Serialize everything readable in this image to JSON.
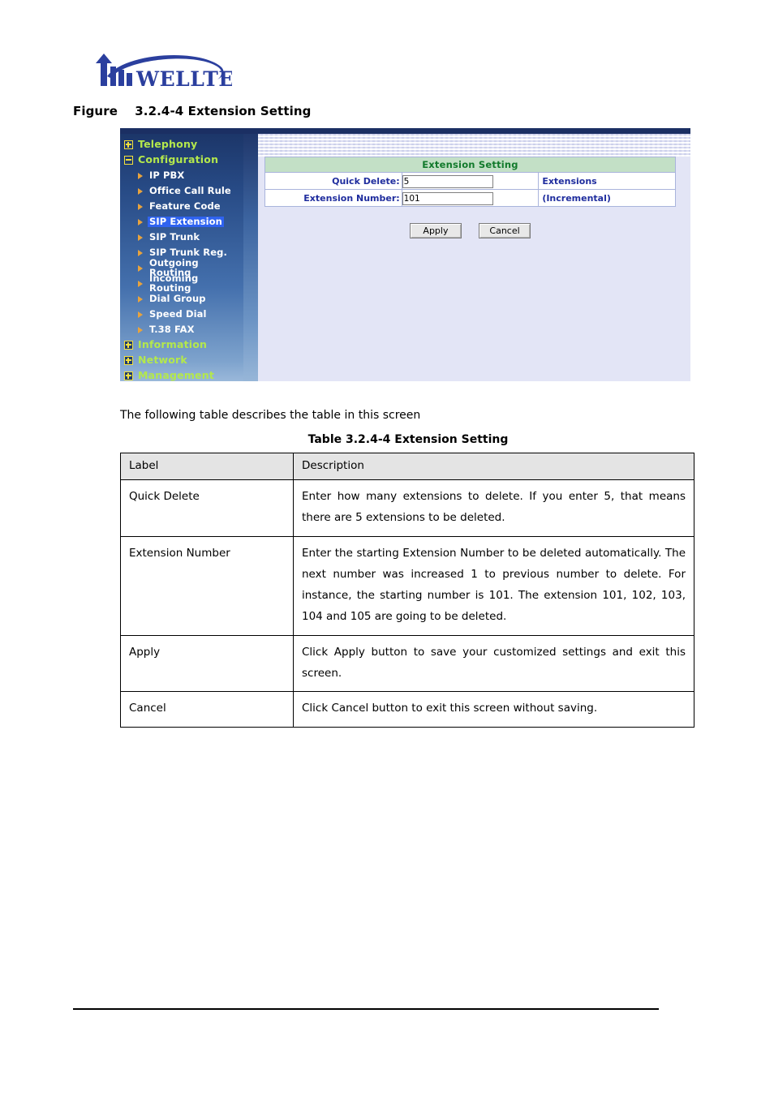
{
  "brand": {
    "logo_text": "WELLTECH",
    "logo_color": "#2b3f9e"
  },
  "figure": {
    "caption": "Figure    3.2.4-4 Extension Setting"
  },
  "device_ui": {
    "sidebar": {
      "top_items": [
        {
          "label": "Telephony",
          "state": "collapsed",
          "icon": "plus-box-icon"
        },
        {
          "label": "Configuration",
          "state": "expanded",
          "icon": "minus-box-icon"
        },
        {
          "label": "Information",
          "state": "collapsed",
          "icon": "plus-box-icon"
        },
        {
          "label": "Network",
          "state": "collapsed",
          "icon": "plus-box-icon"
        },
        {
          "label": "Management",
          "state": "collapsed",
          "icon": "plus-box-icon"
        }
      ],
      "sub_items": [
        {
          "label": "IP PBX",
          "selected": false
        },
        {
          "label": "Office Call Rule",
          "selected": false
        },
        {
          "label": "Feature Code",
          "selected": false
        },
        {
          "label": "SIP Extension",
          "selected": true
        },
        {
          "label": "SIP Trunk",
          "selected": false
        },
        {
          "label": "SIP Trunk Reg.",
          "selected": false
        },
        {
          "label": "Outgoing Routing",
          "selected": false
        },
        {
          "label": "Incoming Routing",
          "selected": false
        },
        {
          "label": "Dial Group",
          "selected": false
        },
        {
          "label": "Speed Dial",
          "selected": false
        },
        {
          "label": "T.38 FAX",
          "selected": false
        }
      ],
      "selected_label": "SIP Extension",
      "colors": {
        "top_item_text": "#b4e84c",
        "sub_item_text": "#ffffff",
        "selection_highlight": "#2f63f0",
        "arrow": "#e8a33d",
        "box_border": "#f5e23a"
      }
    },
    "form": {
      "header": "Extension Setting",
      "header_text_color": "#127a2c",
      "header_bg_color": "#c3e0c6",
      "fields": [
        {
          "label": "Quick Delete:",
          "value": "5",
          "placeholder": "",
          "hint": "Extensions"
        },
        {
          "label": "Extension Number:",
          "value": "101",
          "placeholder": "",
          "hint": "(Incremental)"
        }
      ],
      "buttons": {
        "apply": "Apply",
        "cancel": "Cancel"
      }
    }
  },
  "body": {
    "intro": "The following table describes the table in this screen",
    "table_caption": "Table 3.2.4-4 Extension Setting"
  },
  "doc_table": {
    "headers": [
      "Label",
      "Description"
    ],
    "rows": [
      {
        "label": "Quick Delete",
        "description": "Enter how many extensions to delete. If you enter 5, that means there are 5 extensions to be deleted."
      },
      {
        "label": "Extension Number",
        "description": "Enter the starting Extension Number to be deleted automatically. The next number was increased 1 to previous number to delete. For instance, the starting number is 101. The extension 101, 102, 103, 104 and 105 are going to be deleted."
      },
      {
        "label": "Apply",
        "description": "Click Apply button to save your customized settings and exit this screen."
      },
      {
        "label": "Cancel",
        "description": "Click Cancel button to exit this screen without saving."
      }
    ]
  }
}
